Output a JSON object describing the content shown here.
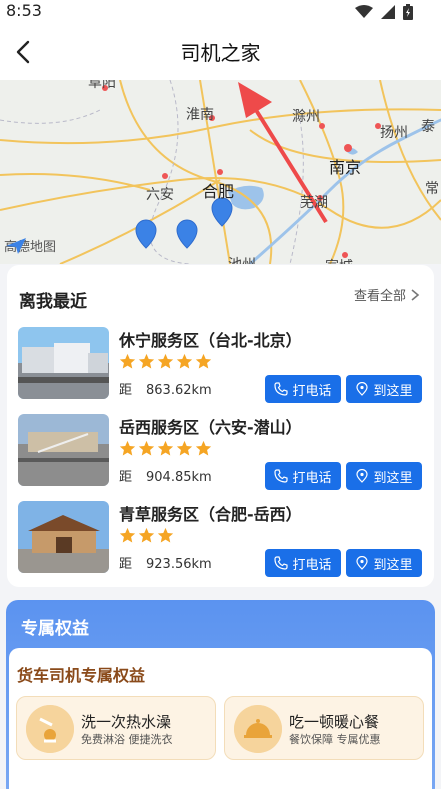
{
  "status_bar": {
    "time": "8:53"
  },
  "header": {
    "title": "司机之家"
  },
  "map": {
    "cities": [
      "阜阳",
      "淮南",
      "滁州",
      "扬州",
      "泰",
      "南京",
      "六安",
      "合肥",
      "芜湖",
      "常",
      "池州",
      "宣城"
    ],
    "logo_text": "高德地图"
  },
  "nearby": {
    "title": "离我最近",
    "view_all": "查看全部",
    "distance_label": "距",
    "call_label": "打电话",
    "go_label": "到这里",
    "stations": [
      {
        "name": "休宁服务区（台北-北京）",
        "rating": 5,
        "distance": "863.62km"
      },
      {
        "name": "岳西服务区（六安-潜山）",
        "rating": 5,
        "distance": "904.85km"
      },
      {
        "name": "青草服务区（合肥-岳西）",
        "rating": 3,
        "distance": "923.56km"
      }
    ]
  },
  "benefits": {
    "header": "专属权益",
    "subtitle": "货车司机专属权益",
    "items": [
      {
        "title": "洗一次热水澡",
        "desc": "免费淋浴 便捷洗衣"
      },
      {
        "title": "吃一顿暖心餐",
        "desc": "餐饮保障 专属优惠"
      }
    ]
  },
  "colors": {
    "primary": "#1a6fe8",
    "star": "#f5a524",
    "benefit_bg": "#5b93f0"
  }
}
